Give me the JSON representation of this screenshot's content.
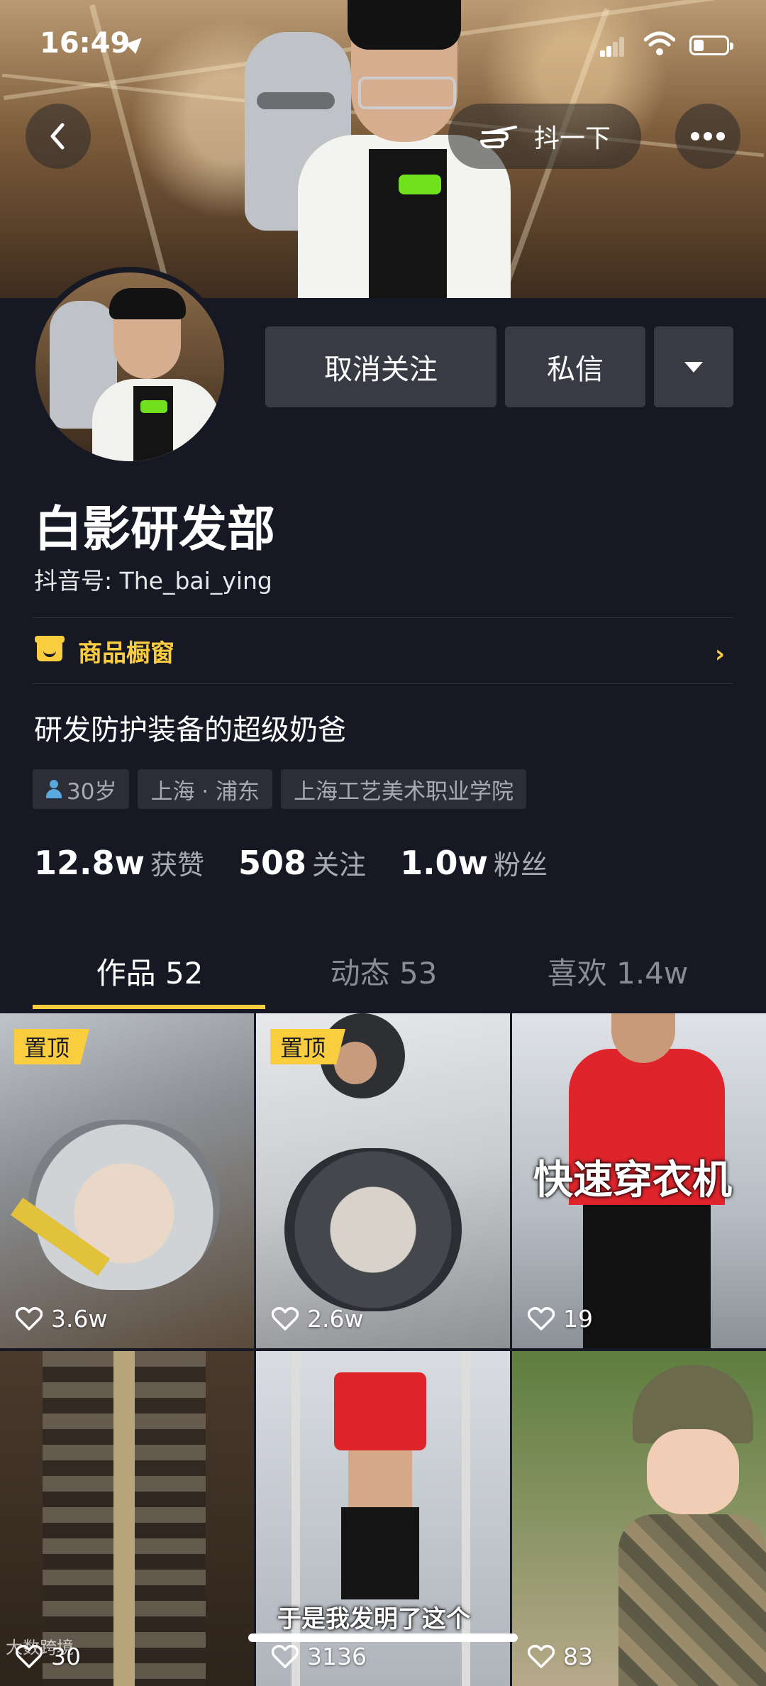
{
  "status_bar": {
    "time": "16:49"
  },
  "header": {
    "back_icon": "chevron-left-icon",
    "dou_button_label": "抖一下",
    "more_icon": "more-dots-icon"
  },
  "profile": {
    "unfollow_label": "取消关注",
    "message_label": "私信",
    "name": "白影研发部",
    "douyin_id": "抖音号: The_bai_ying",
    "shop_label": "商品橱窗",
    "bio": "研发防护装备的超级奶爸",
    "tags": {
      "age": "30岁",
      "location": "上海 · 浦东",
      "school": "上海工艺美术职业学院"
    },
    "stats": {
      "likes_num": "12.8w",
      "likes_label": "获赞",
      "following_num": "508",
      "following_label": "关注",
      "fans_num": "1.0w",
      "fans_label": "粉丝"
    },
    "accent_color": "#facd3f"
  },
  "tabs": [
    {
      "label": "作品 52",
      "active": true
    },
    {
      "label": "动态 53",
      "active": false
    },
    {
      "label": "喜欢 1.4w",
      "active": false
    }
  ],
  "videos": [
    {
      "pin": "置顶",
      "likes": "3.6w",
      "caption": ""
    },
    {
      "pin": "置顶",
      "likes": "2.6w",
      "caption": ""
    },
    {
      "pin": "",
      "likes": "19",
      "caption": "快速穿衣机"
    },
    {
      "pin": "",
      "likes": "30",
      "caption": ""
    },
    {
      "pin": "",
      "likes": "3136",
      "caption": "于是我发明了这个"
    },
    {
      "pin": "",
      "likes": "83",
      "caption": ""
    }
  ],
  "watermark": "大数跨境"
}
